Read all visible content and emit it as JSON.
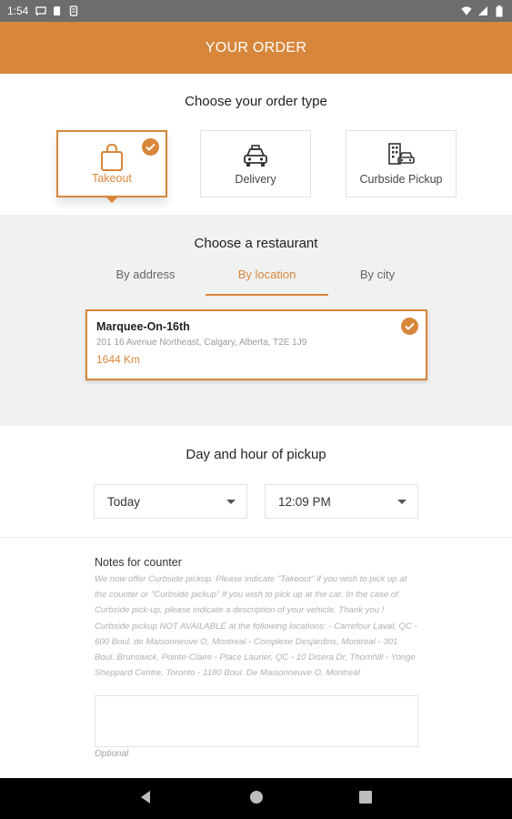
{
  "status_bar": {
    "time": "1:54",
    "left_icons": [
      "cast-icon",
      "sd-card-icon",
      "storage-icon"
    ],
    "right_icons": [
      "wifi-icon",
      "signal-icon",
      "battery-icon"
    ]
  },
  "header": {
    "title": "YOUR ORDER"
  },
  "order_type": {
    "title": "Choose your order type",
    "options": [
      {
        "label": "Takeout",
        "icon": "shopping-bag-icon",
        "selected": true
      },
      {
        "label": "Delivery",
        "icon": "car-icon",
        "selected": false
      },
      {
        "label": "Curbside Pickup",
        "icon": "curbside-building-car-icon",
        "selected": false
      }
    ]
  },
  "restaurant": {
    "title": "Choose a restaurant",
    "tabs": [
      {
        "label": "By address",
        "active": false
      },
      {
        "label": "By location",
        "active": true
      },
      {
        "label": "By city",
        "active": false
      }
    ],
    "selected": {
      "name": "Marquee-On-16th",
      "address": "201 16 Avenue Northeast, Calgary, Alberta, T2E 1J9",
      "distance": "1644 Km"
    }
  },
  "pickup": {
    "title": "Day and hour of pickup",
    "day_value": "Today",
    "time_value": "12:09 PM"
  },
  "notes": {
    "label": "Notes for counter",
    "hint": "We now offer Curbside pickup. Please indicate \"Takeout\" if you wish to pick up at the counter or \"Curbside pickup\" if you wish to pick up at the car. In the case of Curbside pick-up, please indicate a description of your vehicle. Thank you ! Curbside pickup NOT AVAILABLE at the following locations: - Carrefour Laval, QC - 600 Boul. de Maisonneuve O, Montreal - Complexe Desjardins, Montreal - 301 Boul. Brunswick, Pointe-Claire - Place Laurier, QC - 10 Disera Dr, Thornhill - Yonge Sheppard Centre, Toronto - 1180 Boul. De Maisonneuve O, Montreal",
    "value": "",
    "optional": "Optional"
  },
  "colors": {
    "accent": "#d7863b",
    "header_bg": "#d7863b",
    "status_bar": "#6d6d6d",
    "section_bg": "#f1f1f1"
  }
}
